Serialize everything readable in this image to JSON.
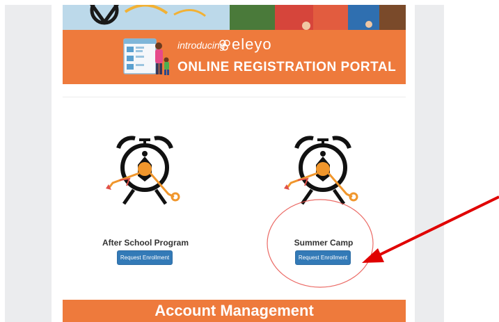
{
  "banner": {
    "intro": "introducing",
    "logo": "eleyo",
    "title": "ONLINE REGISTRATION PORTAL"
  },
  "programs": [
    {
      "label": "After School Program",
      "button_label": "Request Enrollment",
      "icon": "alarm-clock-icon"
    },
    {
      "label": "Summer Camp",
      "button_label": "Request Enrollment",
      "icon": "alarm-clock-icon"
    }
  ],
  "account": {
    "title": "Account Management"
  },
  "colors": {
    "brand_orange": "#ee7a3c",
    "button_blue": "#337ab7",
    "annotation_red": "#e00000"
  }
}
